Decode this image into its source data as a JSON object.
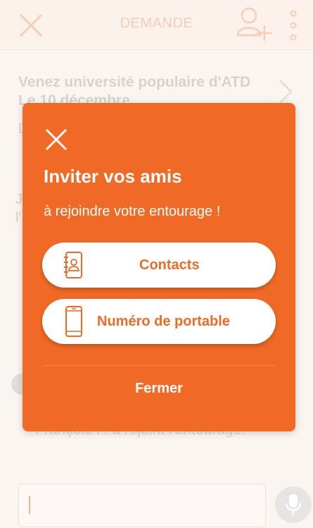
{
  "header": {
    "title": "DEMANDE",
    "close_icon": "close-icon",
    "add_user_icon": "add-user-icon",
    "more_icon": "more-vertical-icon"
  },
  "background": {
    "card_title": "Venez université populaire d'ATD Le 10 décembre",
    "fragment_d": "D",
    "fragment_j": "J",
    "fragment_l": "l'",
    "message": "François P. a rejoint l'entourage."
  },
  "dialog": {
    "title": "Inviter vos amis",
    "subtitle": "à rejoindre votre entourage !",
    "contacts_label": "Contacts",
    "phone_label": "Numéro de portable",
    "close_label": "Fermer"
  },
  "composer": {
    "mic_icon": "microphone-icon"
  },
  "colors": {
    "accent": "#f06a25",
    "button_text": "#ee6a25",
    "faded_accent": "#f6cdb4"
  }
}
